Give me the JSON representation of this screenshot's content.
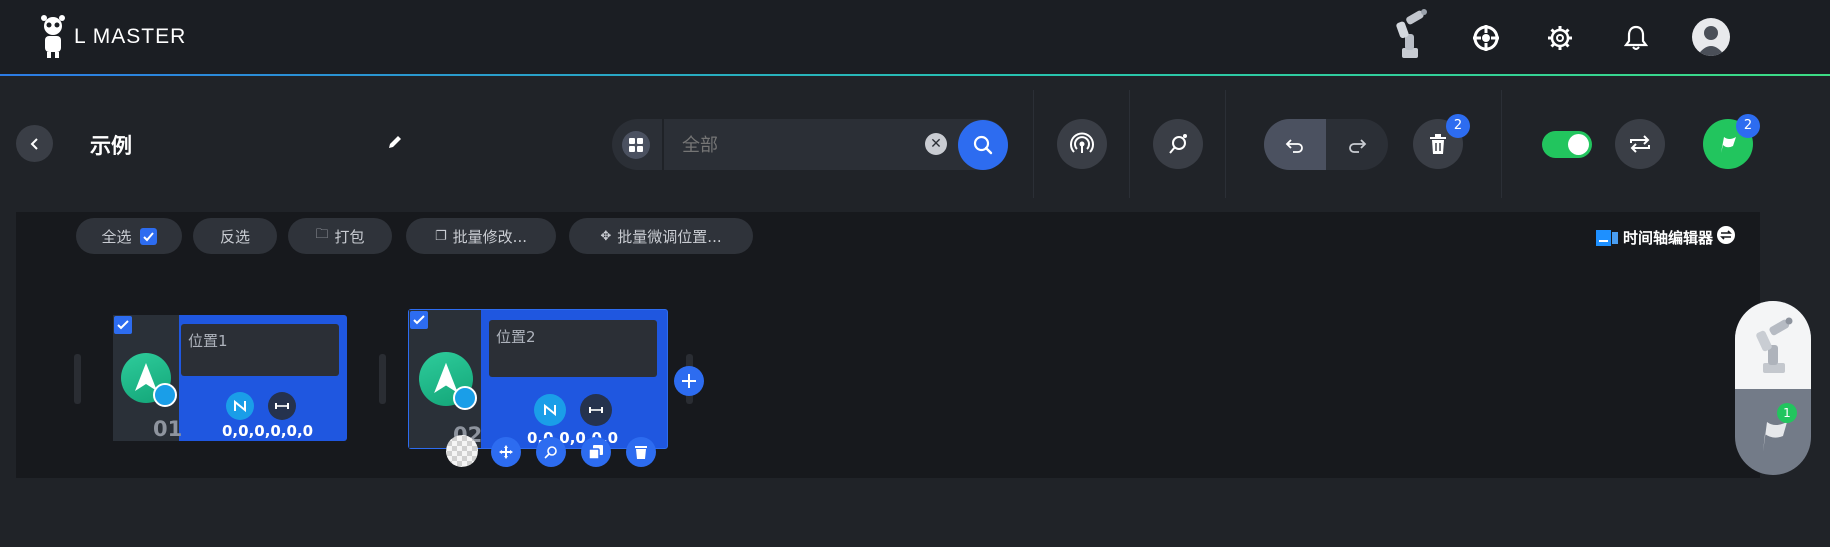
{
  "header": {
    "app_name": "L MASTER",
    "icons": [
      "robot-arm-icon",
      "target-icon",
      "gear-icon",
      "bell-icon",
      "avatar"
    ]
  },
  "toolbar": {
    "title": "示例",
    "search_placeholder": "全部",
    "delete_badge": "2",
    "run_badge": "2",
    "toggle_on": true
  },
  "actions": {
    "select_all": "全选",
    "invert": "反选",
    "pack": "打包",
    "batch_edit": "批量修改...",
    "batch_fine_tune": "批量微调位置...",
    "timeline_editor": "时间轴编辑器"
  },
  "cards": [
    {
      "index": "01",
      "name": "位置1",
      "coords": "0,0,0,0,0,0",
      "checked": true
    },
    {
      "index": "02",
      "name": "位置2",
      "coords": "0,0,0,0,0,0",
      "checked": true
    }
  ],
  "dock": {
    "flag_badge": "1"
  },
  "colors": {
    "accent": "#2d6cf0",
    "green": "#22c55e",
    "card": "#1f57e0"
  }
}
